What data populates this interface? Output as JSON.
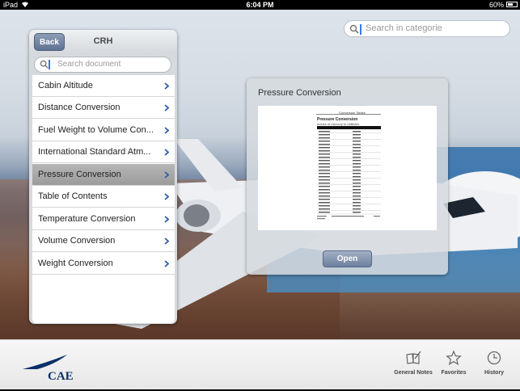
{
  "status_bar": {
    "device": "iPad",
    "time": "6:04 PM",
    "battery": "60%"
  },
  "top_search": {
    "placeholder": "Search in categorie"
  },
  "panel": {
    "back_label": "Back",
    "title": "CRH",
    "search_placeholder": "Search document",
    "items": [
      {
        "label": "Cabin Altitude"
      },
      {
        "label": "Distance Conversion"
      },
      {
        "label": "Fuel Weight to Volume Con..."
      },
      {
        "label": "International Standard Atm..."
      },
      {
        "label": "Pressure Conversion",
        "selected": true
      },
      {
        "label": "Table of Contents"
      },
      {
        "label": "Temperature Conversion"
      },
      {
        "label": "Volume Conversion"
      },
      {
        "label": "Weight Conversion"
      }
    ]
  },
  "preview": {
    "title": "Pressure Conversion",
    "doc": {
      "header": "Conversion Tables",
      "title": "Pressure Conversion",
      "subtitle": "Inches of mercury to millibars"
    },
    "open_label": "Open"
  },
  "toolbar": {
    "logo_text": "CAE",
    "items": [
      {
        "label": "General Notes",
        "icon": "notes-icon"
      },
      {
        "label": "Favorites",
        "icon": "star-icon"
      },
      {
        "label": "History",
        "icon": "clock-icon"
      }
    ]
  },
  "colors": {
    "accent": "#3478f6",
    "chevron": "#2a5fb3",
    "logo": "#0d2f69"
  }
}
